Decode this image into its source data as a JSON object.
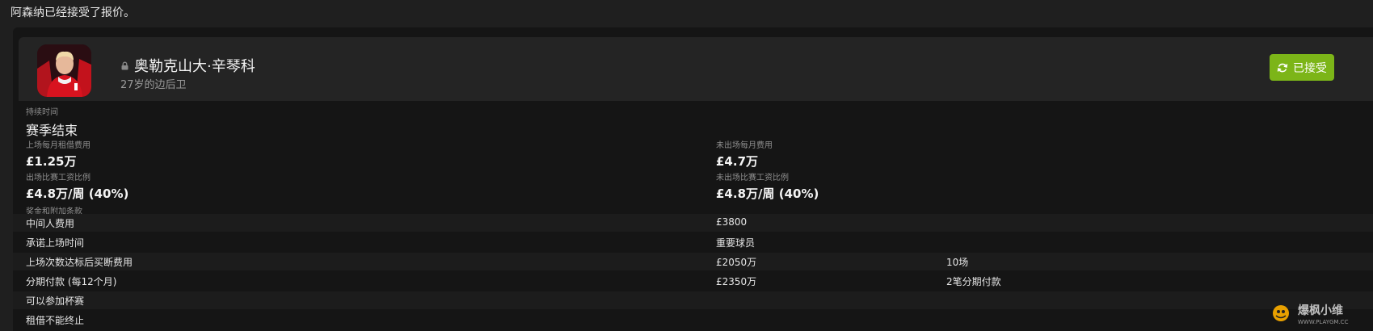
{
  "message": "阿森纳已经接受了报价。",
  "player": {
    "name": "奥勒克山大·辛琴科",
    "subtitle": "27岁的边后卫"
  },
  "status_button": {
    "label": "已接受"
  },
  "details": {
    "duration": {
      "label": "持续时间",
      "value": "赛季结束"
    },
    "monthly_loan_fee_played": {
      "label": "上场每月租借费用",
      "value": "£1.25万"
    },
    "monthly_fee_not_played": {
      "label": "未出场每月费用",
      "value": "£4.7万"
    },
    "wage_share_played": {
      "label": "出场比赛工资比例",
      "value": "£4.8万/周 (40%)"
    },
    "wage_share_not_played": {
      "label": "未出场比赛工资比例",
      "value": "£4.8万/周 (40%)"
    }
  },
  "clauses": {
    "label": "奖金和附加条款",
    "rows": [
      {
        "name": "中间人费用",
        "value": "£3800",
        "extra": ""
      },
      {
        "name": "承诺上场时间",
        "value": "重要球员",
        "extra": ""
      },
      {
        "name": "上场次数达标后买断费用",
        "value": "£2050万",
        "extra": "10场"
      },
      {
        "name": "分期付款 (每12个月)",
        "value": "£2350万",
        "extra": "2笔分期付款"
      },
      {
        "name": "可以参加杯赛",
        "value": "",
        "extra": ""
      },
      {
        "name": "租借不能终止",
        "value": "",
        "extra": ""
      }
    ]
  },
  "watermark": {
    "text": "爆枫小维",
    "url": "WWW.PLAYGM.CC"
  },
  "colors": {
    "accent": "#7cb518",
    "background": "#1f1f1f",
    "panel": "#151515",
    "card": "#242424"
  },
  "icons": {
    "status": "refresh-icon",
    "privacy": "lock-icon"
  }
}
